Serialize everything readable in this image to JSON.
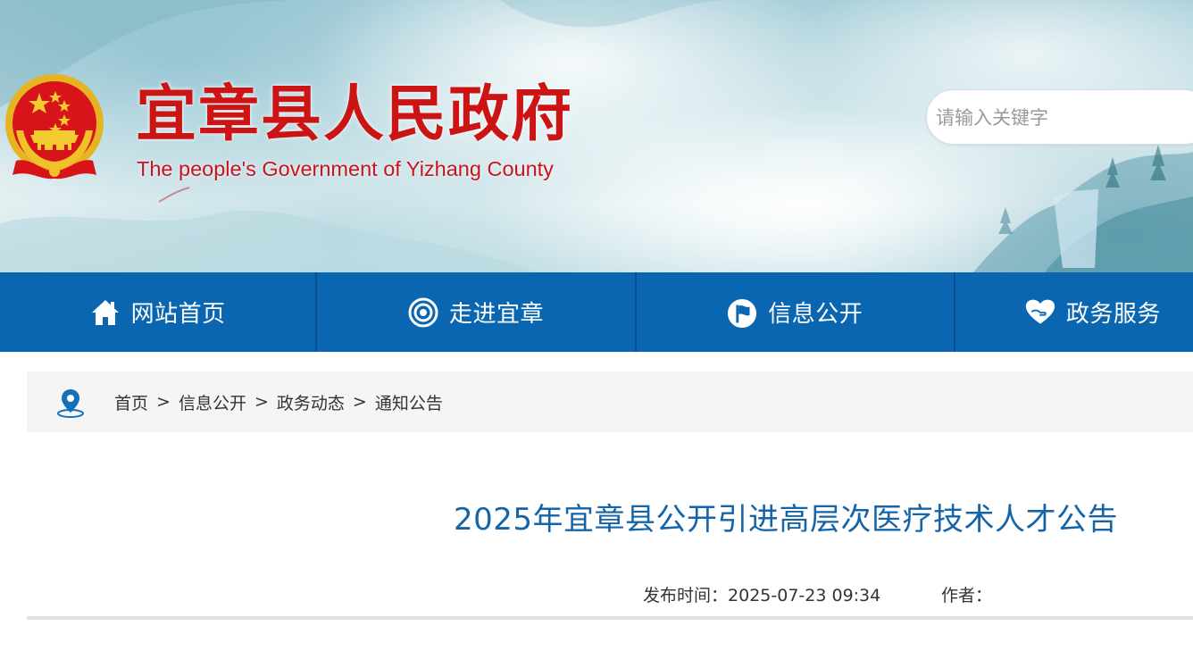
{
  "header": {
    "title": "宜章县人民政府",
    "subtitle": "The people's Government of Yizhang County",
    "search": {
      "placeholder": "请输入关键字",
      "value": ""
    }
  },
  "nav": {
    "items": [
      {
        "label": "网站首页",
        "icon": "home-icon"
      },
      {
        "label": "走进宜章",
        "icon": "target-icon"
      },
      {
        "label": "信息公开",
        "icon": "flag-icon"
      },
      {
        "label": "政务服务",
        "icon": "heart-hand-icon"
      }
    ]
  },
  "breadcrumb": {
    "icon": "location-pin-icon",
    "items": [
      "首页",
      "信息公开",
      "政务动态",
      "通知公告"
    ],
    "separator": ">"
  },
  "article": {
    "title": "2025年宜章县公开引进高层次医疗技术人才公告",
    "publish_label": "发布时间：",
    "publish_time": "2025-07-23 09:34",
    "author_label": "作者：",
    "author": ""
  },
  "colors": {
    "nav_bg": "#0a66b0",
    "title_red": "#cc1414",
    "article_title_blue": "#1664a8",
    "breadcrumb_bg": "#f5f5f6"
  }
}
